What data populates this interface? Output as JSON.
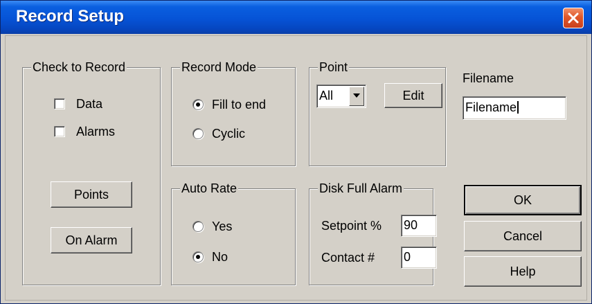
{
  "window": {
    "title": "Record Setup"
  },
  "check_to_record": {
    "legend": "Check to Record",
    "data": {
      "label": "Data",
      "checked": false
    },
    "alarms": {
      "label": "Alarms",
      "checked": false
    },
    "points_button": "Points",
    "on_alarm_button": "On Alarm"
  },
  "record_mode": {
    "legend": "Record Mode",
    "options": [
      {
        "label": "Fill to end",
        "selected": true
      },
      {
        "label": "Cyclic",
        "selected": false
      }
    ]
  },
  "point": {
    "legend": "Point",
    "selected_value": "All",
    "edit_button": "Edit"
  },
  "filename": {
    "label": "Filename",
    "value": "Filename"
  },
  "auto_rate": {
    "legend": "Auto Rate",
    "options": [
      {
        "label": "Yes",
        "selected": false
      },
      {
        "label": "No",
        "selected": true
      }
    ]
  },
  "disk_full_alarm": {
    "legend": "Disk Full Alarm",
    "setpoint_label": "Setpoint %",
    "setpoint_value": "90",
    "contact_label": "Contact #",
    "contact_value": "0"
  },
  "buttons": {
    "ok": "OK",
    "cancel": "Cancel",
    "help": "Help"
  },
  "colors": {
    "titlebar": "#0653d6",
    "face": "#d4d0c8",
    "close": "#e0582a"
  }
}
